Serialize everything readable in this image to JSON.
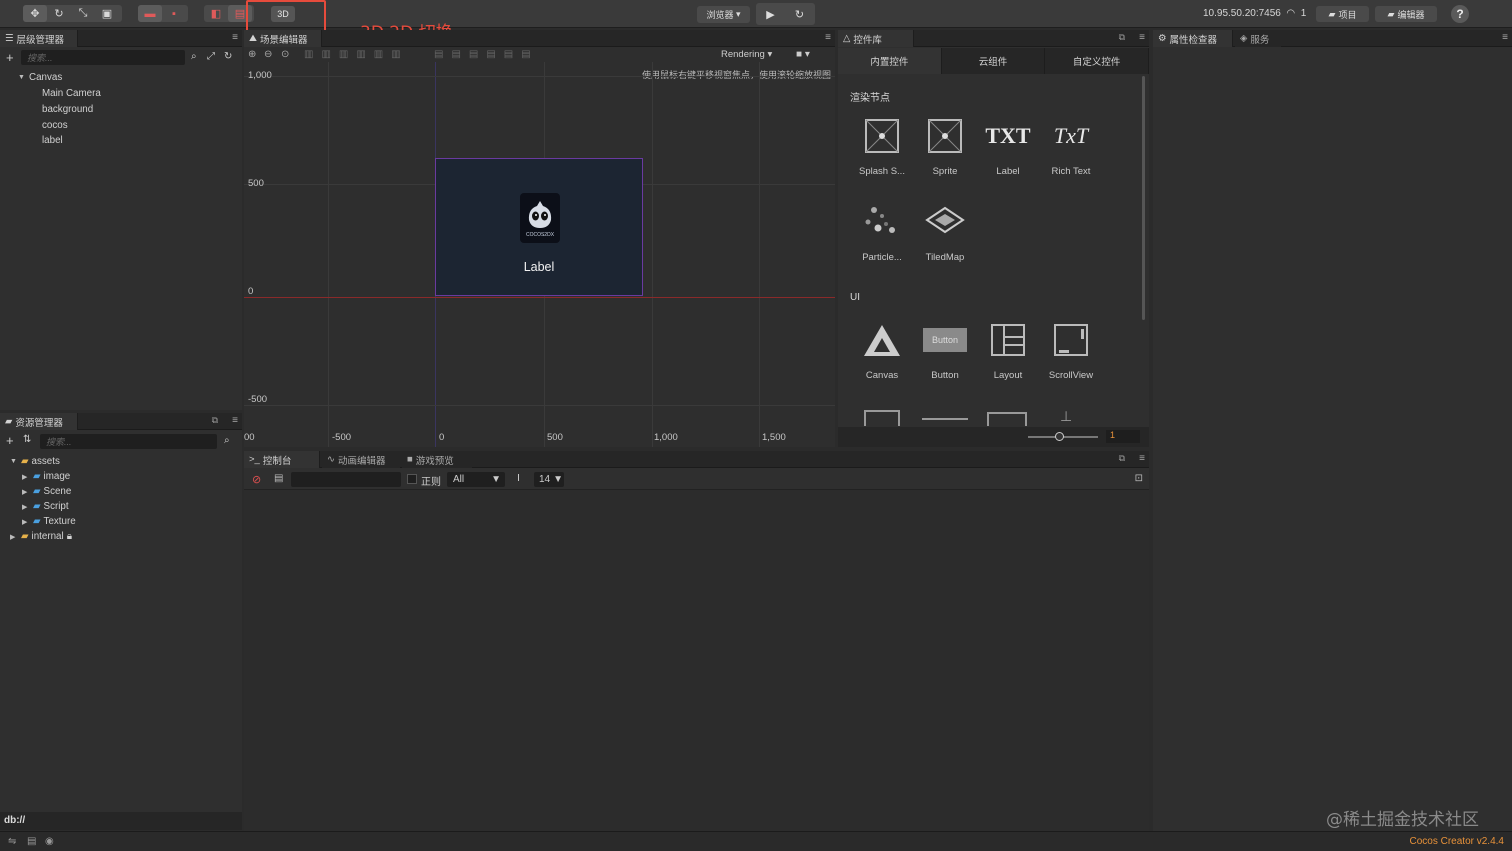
{
  "toolbar": {
    "btn_3d": "3D",
    "annotation": "3D 2D 切换",
    "browser_label": "浏览器",
    "ip": "10.95.50.20:7456",
    "wifi_count": "1",
    "project_label": "项目",
    "editor_label": "编辑器",
    "help": "?"
  },
  "hierarchy": {
    "title": "层级管理器",
    "search_placeholder": "搜索...",
    "items": [
      {
        "label": "Canvas"
      },
      {
        "label": "Main Camera"
      },
      {
        "label": "background"
      },
      {
        "label": "cocos"
      },
      {
        "label": "label"
      }
    ]
  },
  "scene": {
    "title": "场景编辑器",
    "rendering": "Rendering",
    "hint": "使用鼠标右键平移视窗焦点，使用滚轮缩放视图",
    "y_labels": [
      "1,000",
      "500",
      "0",
      "-500"
    ],
    "x_labels": [
      "00",
      "-500",
      "0",
      "500",
      "1,000",
      "1,500"
    ],
    "node_label": "Label",
    "logo_text": "COCOS2DX"
  },
  "library": {
    "title": "控件库",
    "tabs": [
      "内置控件",
      "云组件",
      "自定义控件"
    ],
    "sections": [
      {
        "title": "渲染节点",
        "items": [
          "Splash S...",
          "Sprite",
          "Label",
          "Rich Text",
          "Particle...",
          "TiledMap"
        ]
      },
      {
        "title": "UI",
        "items": [
          "Canvas",
          "Button",
          "Layout",
          "ScrollView"
        ]
      }
    ],
    "label_icon_text": "TXT",
    "richtext_icon_text": "TxT",
    "button_icon_text": "Button",
    "zoom_value": "1"
  },
  "assets": {
    "title": "资源管理器",
    "search_placeholder": "搜索...",
    "items": [
      {
        "label": "assets"
      },
      {
        "label": "image"
      },
      {
        "label": "Scene"
      },
      {
        "label": "Script"
      },
      {
        "label": "Texture"
      },
      {
        "label": "internal"
      }
    ],
    "db_path": "db://"
  },
  "console": {
    "tabs": [
      "控制台",
      "动画编辑器",
      "游戏预览"
    ],
    "regex_label": "正则",
    "filter_value": "All",
    "font_size": "14"
  },
  "inspector": {
    "tabs": [
      "属性检查器",
      "服务"
    ]
  },
  "footer": {
    "version": "Cocos Creator v2.4.4",
    "watermark": "@稀土掘金技术社区"
  },
  "colors": {
    "annotation": "#e64b3c",
    "version": "#e8923a",
    "canvas_border": "#6a3aa0",
    "axis_red": "#8a2a2a"
  }
}
